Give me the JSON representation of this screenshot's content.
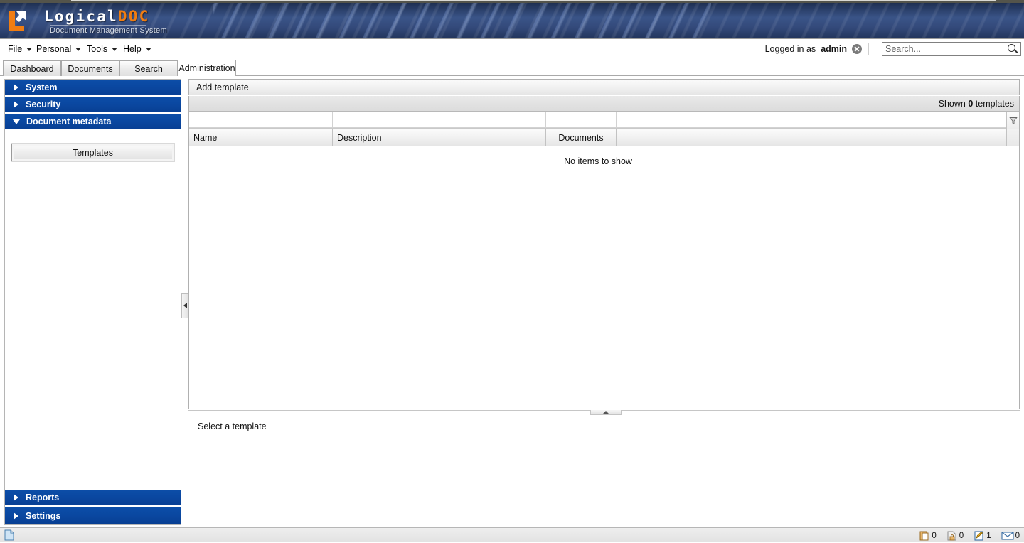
{
  "app": {
    "logo_primary": "Logical",
    "logo_accent": "DOC",
    "logo_subtitle": "Document Management System",
    "accent_color": "#f07d12",
    "banner_color": "#33497a",
    "section_header_color": "#0a47a0"
  },
  "menubar": {
    "items": [
      {
        "label": "File",
        "icon": "chevron-down-icon"
      },
      {
        "label": "Personal",
        "icon": "chevron-down-icon"
      },
      {
        "label": "Tools",
        "icon": "chevron-down-icon"
      },
      {
        "label": "Help",
        "icon": "chevron-down-icon"
      }
    ],
    "login_prefix": "Logged in as",
    "login_user": "admin",
    "logout_icon": "close-circle-icon",
    "search": {
      "placeholder": "Search...",
      "value": "",
      "icon": "search-icon"
    }
  },
  "tabs": [
    {
      "label": "Dashboard",
      "active": false
    },
    {
      "label": "Documents",
      "active": false
    },
    {
      "label": "Search",
      "active": false
    },
    {
      "label": "Administration",
      "active": true
    }
  ],
  "sidebar": {
    "sections": [
      {
        "label": "System",
        "expanded": false,
        "icon": "triangle-right-icon"
      },
      {
        "label": "Security",
        "expanded": false,
        "icon": "triangle-right-icon"
      },
      {
        "label": "Document metadata",
        "expanded": true,
        "icon": "triangle-down-icon"
      }
    ],
    "selected_item": "Templates",
    "bottom_sections": [
      {
        "label": "Reports",
        "expanded": false,
        "icon": "triangle-right-icon"
      },
      {
        "label": "Settings",
        "expanded": false,
        "icon": "triangle-right-icon"
      }
    ],
    "collapse_icon": "triangle-left-icon"
  },
  "main": {
    "toolbar": {
      "add_label": "Add template"
    },
    "info": {
      "shown_prefix": "Shown",
      "shown_count": "0",
      "shown_suffix": "templates"
    },
    "grid": {
      "columns": [
        {
          "label": "Name",
          "align": "left"
        },
        {
          "label": "Description",
          "align": "left"
        },
        {
          "label": "Documents",
          "align": "center"
        },
        {
          "label": "",
          "align": "left"
        }
      ],
      "rows": [],
      "empty_text": "No items to show",
      "filter_icon": "funnel-icon"
    },
    "splitter_icon": "triangle-up-icon",
    "detail_placeholder": "Select a template"
  },
  "statusbar": {
    "left_icon": "document-icon",
    "items": [
      {
        "icon": "clipboard-icon",
        "count": "0"
      },
      {
        "icon": "locked-document-icon",
        "count": "0"
      },
      {
        "icon": "checkout-pencil-icon",
        "count": "1"
      },
      {
        "icon": "envelope-icon",
        "count": "0"
      }
    ]
  }
}
